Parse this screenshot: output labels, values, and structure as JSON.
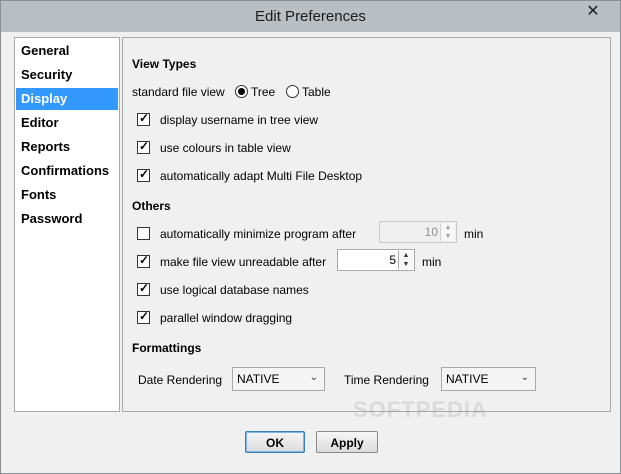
{
  "window": {
    "title": "Edit Preferences"
  },
  "nav": {
    "items": [
      {
        "label": "General"
      },
      {
        "label": "Security"
      },
      {
        "label": "Display"
      },
      {
        "label": "Editor"
      },
      {
        "label": "Reports"
      },
      {
        "label": "Confirmations"
      },
      {
        "label": "Fonts"
      },
      {
        "label": "Password"
      }
    ],
    "selected": "Display"
  },
  "view_types": {
    "heading": "View Types",
    "standard_file_view_label": "standard file view",
    "radio_tree_label": "Tree",
    "radio_table_label": "Table",
    "selected": "Tree",
    "display_username_label": "display username in tree view",
    "display_username_checked": true,
    "use_colours_label": "use colours in table view",
    "use_colours_checked": true,
    "auto_adapt_label": "automatically adapt Multi File Desktop",
    "auto_adapt_checked": true
  },
  "others": {
    "heading": "Others",
    "auto_minimize_label": "automatically minimize program after",
    "auto_minimize_checked": false,
    "auto_minimize_value": "10",
    "auto_minimize_unit": "min",
    "unreadable_label": "make file view unreadable after",
    "unreadable_checked": true,
    "unreadable_value": "5",
    "unreadable_unit": "min",
    "logical_db_label": "use logical database names",
    "logical_db_checked": true,
    "parallel_drag_label": "parallel window dragging",
    "parallel_drag_checked": true
  },
  "formattings": {
    "heading": "Formattings",
    "date_rendering_label": "Date Rendering",
    "date_rendering_value": "NATIVE",
    "time_rendering_label": "Time Rendering",
    "time_rendering_value": "NATIVE"
  },
  "buttons": {
    "ok_label": "OK",
    "apply_label": "Apply"
  },
  "watermark": "SOFTPEDIA",
  "icons": {
    "close": "close-icon",
    "check": "check-icon",
    "spin_up": "arrow-up-icon",
    "spin_down": "arrow-down-icon",
    "combo": "chevron-down-icon"
  }
}
